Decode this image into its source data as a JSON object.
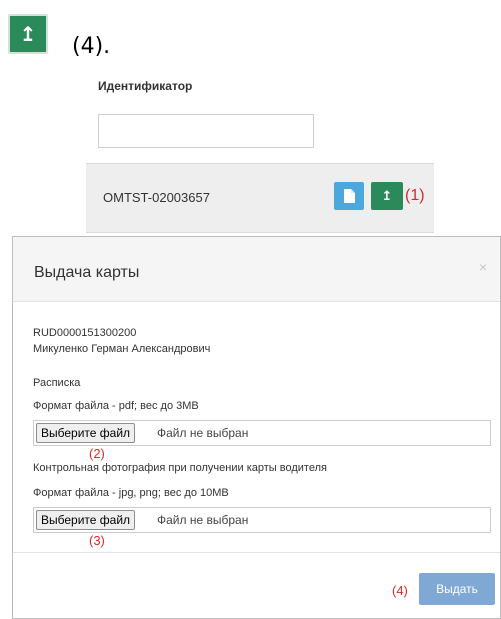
{
  "top_caption_clipped": "     ",
  "top_caption_step": "(4).",
  "id_column_label": "Идентификатор",
  "row": {
    "identifier": "OMTST-02003657",
    "callout_1": "(1)"
  },
  "modal": {
    "title": "Выдача карты",
    "close_symbol": "×",
    "record_code": "RUD0000151300200",
    "person_name": "Микуленко Герман Александрович",
    "receipt_label": "Расписка",
    "receipt_format": "Формат файла - pdf; вес до 3MB",
    "photo_label": "Контрольная фотография при получении карты водителя",
    "photo_format": "Формат файла - jpg, png; вес до 10MB",
    "choose_file": "Выберите файл",
    "no_file": "Файл не выбран",
    "callout_2": "(2)",
    "callout_3": "(3)",
    "callout_4": "(4)",
    "issue_button": "Выдать"
  },
  "colors": {
    "green": "#2a8a5a",
    "blue": "#4aa8dc",
    "issue_button": "#7fa9d4",
    "callout_red": "#d92b2b"
  }
}
